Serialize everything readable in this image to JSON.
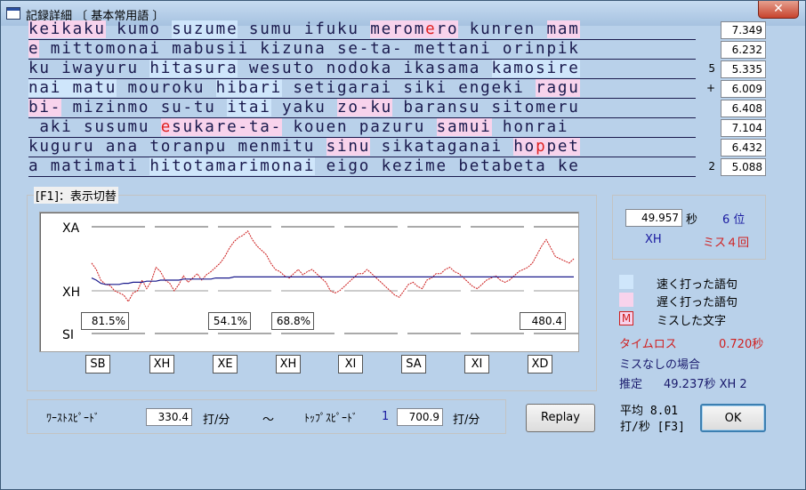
{
  "window": {
    "title": "記録詳細 〔 基本常用語 〕",
    "close_label": "✕"
  },
  "colors": {
    "fast": "#cfe6fb",
    "slow": "#f8d3ec",
    "miss": "#e02020",
    "avg_line": "#1a1a8c",
    "speed_line": "#cc1a1a"
  },
  "lines": [
    {
      "segments": [
        {
          "t": "keikaku",
          "k": "slow"
        },
        {
          "t": " kumo "
        },
        {
          "t": "suzume",
          "k": "fast"
        },
        {
          "t": " sumu ifuku "
        },
        {
          "t": "merom",
          "k": "slow"
        },
        {
          "t": "e",
          "k": "slow miss"
        },
        {
          "t": "ro",
          "k": "slow"
        },
        {
          "t": " kunren "
        },
        {
          "t": "mam",
          "k": "slow"
        }
      ],
      "mark": "",
      "time": "7.349"
    },
    {
      "segments": [
        {
          "t": "e",
          "k": "slow"
        },
        {
          "t": " mittomonai mabusii kizuna se-ta- mettani orinpik"
        }
      ],
      "mark": "",
      "time": "6.232"
    },
    {
      "segments": [
        {
          "t": "ku iwayuru "
        },
        {
          "t": "hitasura",
          "k": "fast"
        },
        {
          "t": " wesuto nodoka ikasama "
        },
        {
          "t": "kamosire",
          "k": "fast"
        }
      ],
      "mark": "5",
      "time": "5.335"
    },
    {
      "segments": [
        {
          "t": "nai matu",
          "k": "fast"
        },
        {
          "t": " mouroku "
        },
        {
          "t": "hibari",
          "k": "fast"
        },
        {
          "t": " setigarai siki engeki "
        },
        {
          "t": "ragu",
          "k": "slow"
        }
      ],
      "mark": "+",
      "time": "6.009"
    },
    {
      "segments": [
        {
          "t": "bi-",
          "k": "slow"
        },
        {
          "t": " mizinmo su-tu "
        },
        {
          "t": "itai",
          "k": "fast"
        },
        {
          "t": " yaku "
        },
        {
          "t": "zo-ku",
          "k": "slow"
        },
        {
          "t": " baransu sitomeru"
        }
      ],
      "mark": "",
      "time": "6.408"
    },
    {
      "segments": [
        {
          "t": " aki susumu "
        },
        {
          "t": "e",
          "k": "slow miss"
        },
        {
          "t": "sukare-ta-",
          "k": "slow"
        },
        {
          "t": " kouen pazuru "
        },
        {
          "t": "samui",
          "k": "slow"
        },
        {
          "t": " honrai"
        }
      ],
      "mark": "",
      "time": "7.104"
    },
    {
      "segments": [
        {
          "t": "kuguru ana toranpu menmitu "
        },
        {
          "t": "sinu",
          "k": "slow"
        },
        {
          "t": " sikataganai "
        },
        {
          "t": "ho",
          "k": "slow"
        },
        {
          "t": "p",
          "k": "slow miss"
        },
        {
          "t": "pet",
          "k": "slow"
        }
      ],
      "mark": "",
      "time": "6.432"
    },
    {
      "segments": [
        {
          "t": "a matimati "
        },
        {
          "t": "hitotamarimonai",
          "k": "fast"
        },
        {
          "t": " eigo kezime betabeta ke"
        }
      ],
      "mark": "2",
      "time": "5.088"
    }
  ],
  "display_toggle": {
    "label": "[F1]：表示切替"
  },
  "chart": {
    "y_labels": [
      "XA",
      "XH",
      "SI"
    ],
    "pct_labels": [
      "81.5%",
      "54.1%",
      "68.8%",
      "480.4"
    ],
    "keys": [
      "SB",
      "XH",
      "XE",
      "XH",
      "XI",
      "SA",
      "XI",
      "XD"
    ]
  },
  "chart_data": {
    "type": "line",
    "title": "",
    "xlabel": "",
    "ylabel": "",
    "y_tick_labels": [
      "XA",
      "XH",
      "SI"
    ],
    "grid": true,
    "series": [
      {
        "values": [
          0.66,
          0.6,
          0.5,
          0.46,
          0.45,
          0.4,
          0.38,
          0.36,
          0.3,
          0.38,
          0.4,
          0.5,
          0.42,
          0.49,
          0.62,
          0.58,
          0.5,
          0.47,
          0.4,
          0.46,
          0.54,
          0.48,
          0.52,
          0.56,
          0.5,
          0.55,
          0.58,
          0.62,
          0.66,
          0.72,
          0.8,
          0.86,
          0.9,
          0.92,
          0.96,
          0.88,
          0.82,
          0.78,
          0.74,
          0.66,
          0.6,
          0.58,
          0.54,
          0.52,
          0.56,
          0.6,
          0.55,
          0.58,
          0.6,
          0.56,
          0.52,
          0.48,
          0.4,
          0.38,
          0.4,
          0.44,
          0.48,
          0.52,
          0.56,
          0.56,
          0.6,
          0.56,
          0.52,
          0.48,
          0.44,
          0.4,
          0.36,
          0.34,
          0.4,
          0.46,
          0.48,
          0.44,
          0.42,
          0.5,
          0.52,
          0.56,
          0.56,
          0.6,
          0.62,
          0.58,
          0.56,
          0.52,
          0.48,
          0.44,
          0.42,
          0.46,
          0.5,
          0.52,
          0.54,
          0.5,
          0.48,
          0.5,
          0.54,
          0.58,
          0.6,
          0.62,
          0.66,
          0.74,
          0.82,
          0.88,
          0.8,
          0.72,
          0.7,
          0.68,
          0.66,
          0.7
        ]
      },
      {
        "values": [
          0.52,
          0.5,
          0.47,
          0.46,
          0.46,
          0.46,
          0.46,
          0.47,
          0.47,
          0.48,
          0.48,
          0.48,
          0.49,
          0.49,
          0.49,
          0.5,
          0.5,
          0.5,
          0.5,
          0.5,
          0.51,
          0.51,
          0.51,
          0.51,
          0.51,
          0.51,
          0.51,
          0.52,
          0.52,
          0.52,
          0.52,
          0.53,
          0.53,
          0.53,
          0.53,
          0.53,
          0.53,
          0.53,
          0.53,
          0.53,
          0.53,
          0.53,
          0.53,
          0.53,
          0.53,
          0.53,
          0.53,
          0.53,
          0.53,
          0.53,
          0.53,
          0.53,
          0.53,
          0.53,
          0.53,
          0.53,
          0.53,
          0.53,
          0.53,
          0.53,
          0.53,
          0.53,
          0.53,
          0.53,
          0.53,
          0.53,
          0.53,
          0.53,
          0.53,
          0.53,
          0.53,
          0.53,
          0.53,
          0.53,
          0.53,
          0.53,
          0.53,
          0.53,
          0.53,
          0.53,
          0.53,
          0.53,
          0.53,
          0.53,
          0.53,
          0.53,
          0.53,
          0.53,
          0.53,
          0.53,
          0.53,
          0.53,
          0.53,
          0.53,
          0.53,
          0.53,
          0.53,
          0.53,
          0.53,
          0.53,
          0.53,
          0.53,
          0.53,
          0.53,
          0.53,
          0.53
        ]
      }
    ]
  },
  "result": {
    "time": "49.957",
    "time_unit": "秒",
    "rank": "6 位",
    "grade": "XH",
    "miss": "ミス４回"
  },
  "legend": [
    {
      "label": "速く打った語句",
      "color": "#cfe6fb"
    },
    {
      "label": "遅く打った語句",
      "color": "#f8d3ec"
    },
    {
      "label": "ミスした文字",
      "glyph": "M"
    }
  ],
  "timeloss": {
    "label": "タイムロス",
    "value": "0.720秒"
  },
  "nomiss": {
    "label": "ミスなしの場合",
    "estimate_label": "推定",
    "estimate_value": "49.237秒 XH 2"
  },
  "speeds": {
    "worst_label": "ﾜｰｽﾄｽﾋﾟｰﾄﾞ",
    "worst_value": "330.4",
    "worst_unit": "打/分",
    "tilde": "～",
    "top_label": "ﾄｯﾌﾟｽﾋﾟｰﾄﾞ",
    "top_rank": "1",
    "top_value": "700.9",
    "top_unit": "打/分"
  },
  "buttons": {
    "replay": "Replay",
    "ok": "OK"
  },
  "average": {
    "line1": "平均 8.01",
    "line2": "打/秒 [F3]"
  }
}
